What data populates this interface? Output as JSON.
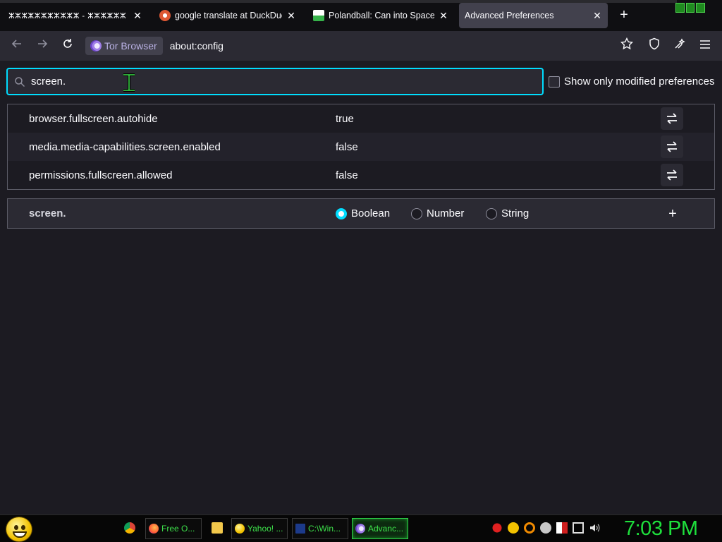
{
  "tabs": [
    {
      "title": "ⵣⵣⵣⵣⵣⵣⵣⵣⵣⵣⵣ - ⵣⵣⵣⵣⵣⵣ",
      "close": "✕"
    },
    {
      "title": "google translate at DuckDuck",
      "close": "✕"
    },
    {
      "title": "Polandball: Can into Space! - F",
      "close": "✕"
    },
    {
      "title": "Advanced Preferences",
      "close": "✕"
    }
  ],
  "new_tab_label": "+",
  "nav": {
    "back_icon": "arrow-left-icon",
    "forward_icon": "arrow-right-icon",
    "reload_icon": "reload-icon",
    "identity_label": "Tor Browser",
    "url": "about:config"
  },
  "search": {
    "value": "screen."
  },
  "show_modified_label": "Show only modified preferences",
  "prefs": [
    {
      "name": "browser.fullscreen.autohide",
      "value": "true"
    },
    {
      "name": "media.media-capabilities.screen.enabled",
      "value": "false"
    },
    {
      "name": "permissions.fullscreen.allowed",
      "value": "false"
    }
  ],
  "add_row": {
    "name": "screen.",
    "options": [
      "Boolean",
      "Number",
      "String"
    ],
    "selected": "Boolean",
    "add_label": "+"
  },
  "taskbar": {
    "tasks": [
      "Free O...",
      "Yahoo! ...",
      "C:\\Win...",
      "Advanc..."
    ],
    "clock": "7:03 PM"
  },
  "colors": {
    "accent": "#00ddff",
    "taskbar_text": "#3de04a",
    "clock": "#1ee03c"
  }
}
